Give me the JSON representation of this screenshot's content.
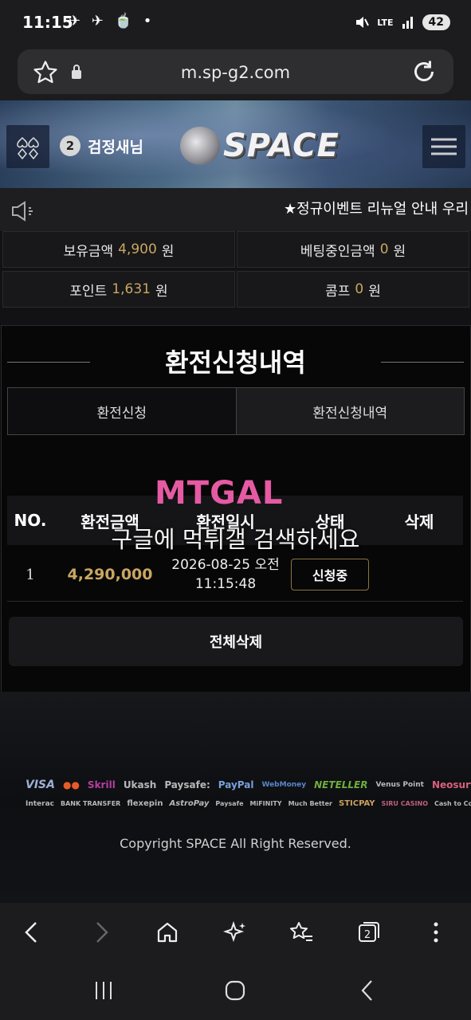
{
  "status": {
    "time": "11:15",
    "left_icons": "✈ ✈ 🍵 •",
    "network": "LTE",
    "battery": "42"
  },
  "browser": {
    "url": "m.sp-g2.com"
  },
  "header": {
    "user_badge": "2",
    "user_name": "검정새님",
    "logo": "SPACE"
  },
  "notice": {
    "text": "★정규이벤트 리뉴얼 안내 우리"
  },
  "balances": {
    "holding_label": "보유금액",
    "holding_value": "4,900",
    "betting_label": "베팅중인금액",
    "betting_value": "0",
    "point_label": "포인트",
    "point_value": "1,631",
    "comp_label": "콤프",
    "comp_value": "0",
    "unit": "원"
  },
  "panel": {
    "title": "환전신청내역",
    "tabs": [
      "환전신청",
      "환전신청내역"
    ],
    "columns": [
      "NO.",
      "환전금액",
      "환전일시",
      "상태",
      "삭제"
    ],
    "rows": [
      {
        "no": "1",
        "amount": "4,290,000",
        "date": "2026-08-25 오전",
        "time": "11:15:48",
        "status": "신청중"
      }
    ],
    "delete_all": "전체삭제"
  },
  "watermark": {
    "logo": "MTGAL",
    "text": "구글에 먹튀갤 검색하세요"
  },
  "payments": {
    "row1": [
      "VISA",
      "●●",
      "Skrill",
      "Ukash",
      "Paysafe:",
      "PayPal",
      "WebMoney",
      "NETELLER",
      "Venus Point",
      "Neosurf"
    ],
    "row2": [
      "Interac",
      "BANK TRANSFER",
      "flexepin",
      "AstroPay",
      "Paysafe",
      "MiFINITY",
      "Much Better",
      "STICPAY",
      "SIRU CASINO",
      "Cash to Code"
    ]
  },
  "footer": {
    "copyright": "Copyright SPACE All Right Reserved."
  },
  "colors": {
    "gold": "#c9a760",
    "badge_border": "#8b7440"
  }
}
